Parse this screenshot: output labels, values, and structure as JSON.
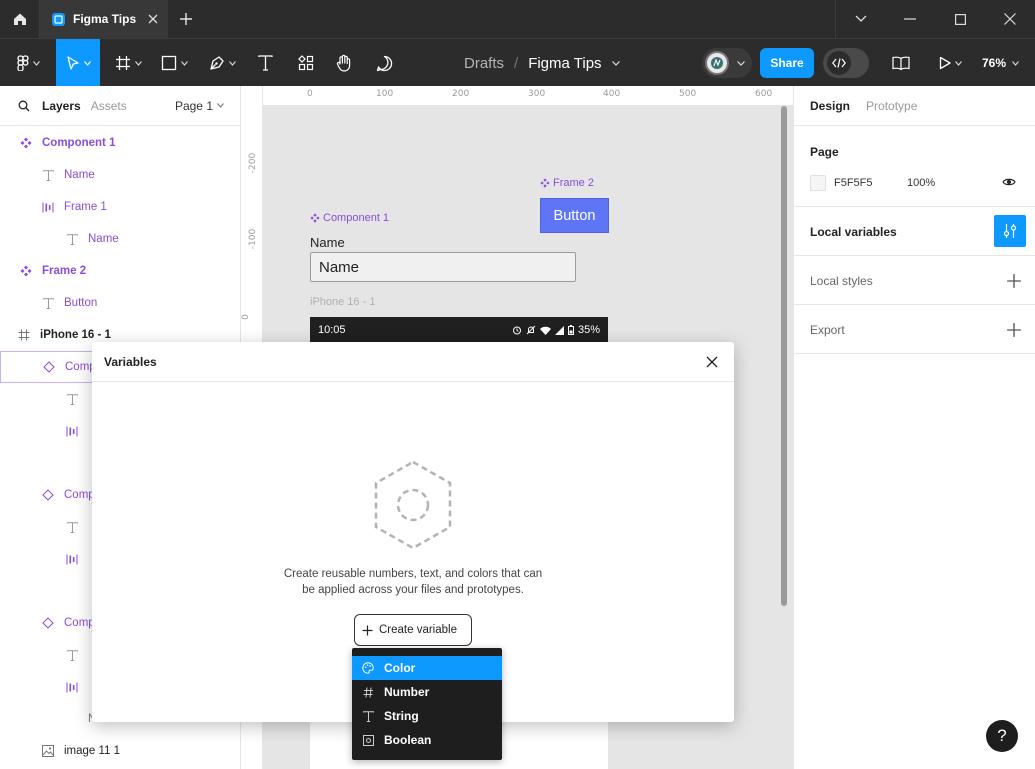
{
  "titlebar": {
    "tab_title": "Figma Tips"
  },
  "toolbar": {
    "breadcrumb_parent": "Drafts",
    "breadcrumb_sep": "/",
    "file_name": "Figma Tips",
    "share_label": "Share",
    "zoom": "76%"
  },
  "left_panel": {
    "tab_layers": "Layers",
    "tab_assets": "Assets",
    "page_select": "Page 1",
    "layers": [
      {
        "label": "Component 1",
        "icon": "component-icon"
      },
      {
        "label": "Name",
        "icon": "text-icon"
      },
      {
        "label": "Frame 1",
        "icon": "autolayout-icon"
      },
      {
        "label": "Name",
        "icon": "text-icon"
      },
      {
        "label": "Frame 2",
        "icon": "component-icon"
      },
      {
        "label": "Button",
        "icon": "text-icon"
      },
      {
        "label": "iPhone 16 - 1",
        "icon": "frame-icon"
      },
      {
        "label": "Comp",
        "icon": "instance-icon"
      },
      {
        "label": "Comp",
        "icon": "instance-icon"
      },
      {
        "label": "Comp",
        "icon": "instance-icon"
      },
      {
        "label": "Name",
        "icon": "text-icon"
      },
      {
        "label": "image 11 1",
        "icon": "image-icon"
      }
    ]
  },
  "canvas": {
    "ruler_x": [
      "0",
      "100",
      "200",
      "300",
      "400",
      "500",
      "600"
    ],
    "ruler_y": [
      "-200",
      "-100",
      "0"
    ],
    "component1_label": "Component 1",
    "name_label": "Name",
    "name_input_value": "Name",
    "frame2_label": "Frame 2",
    "button_label": "Button",
    "phone_label": "iPhone 16 - 1",
    "phone_time": "10:05",
    "phone_battery": "35%"
  },
  "right_panel": {
    "tab_design": "Design",
    "tab_prototype": "Prototype",
    "page_title": "Page",
    "page_color": "F5F5F5",
    "page_opacity": "100%",
    "local_variables": "Local variables",
    "local_styles": "Local styles",
    "export": "Export"
  },
  "variables_modal": {
    "title": "Variables",
    "description_line1": "Create reusable numbers, text, and colors that can",
    "description_line2": "be applied across your files and prototypes.",
    "create_label": "Create variable"
  },
  "type_menu": {
    "items": [
      {
        "label": "Color",
        "icon": "palette-icon"
      },
      {
        "label": "Number",
        "icon": "hash-icon"
      },
      {
        "label": "String",
        "icon": "text-icon"
      },
      {
        "label": "Boolean",
        "icon": "toggle-icon"
      }
    ],
    "selected": "Color"
  },
  "help_label": "?",
  "colors": {
    "accent": "#0d99ff",
    "component_purple": "#8a4cdb",
    "button_fill": "#5e75f6"
  }
}
